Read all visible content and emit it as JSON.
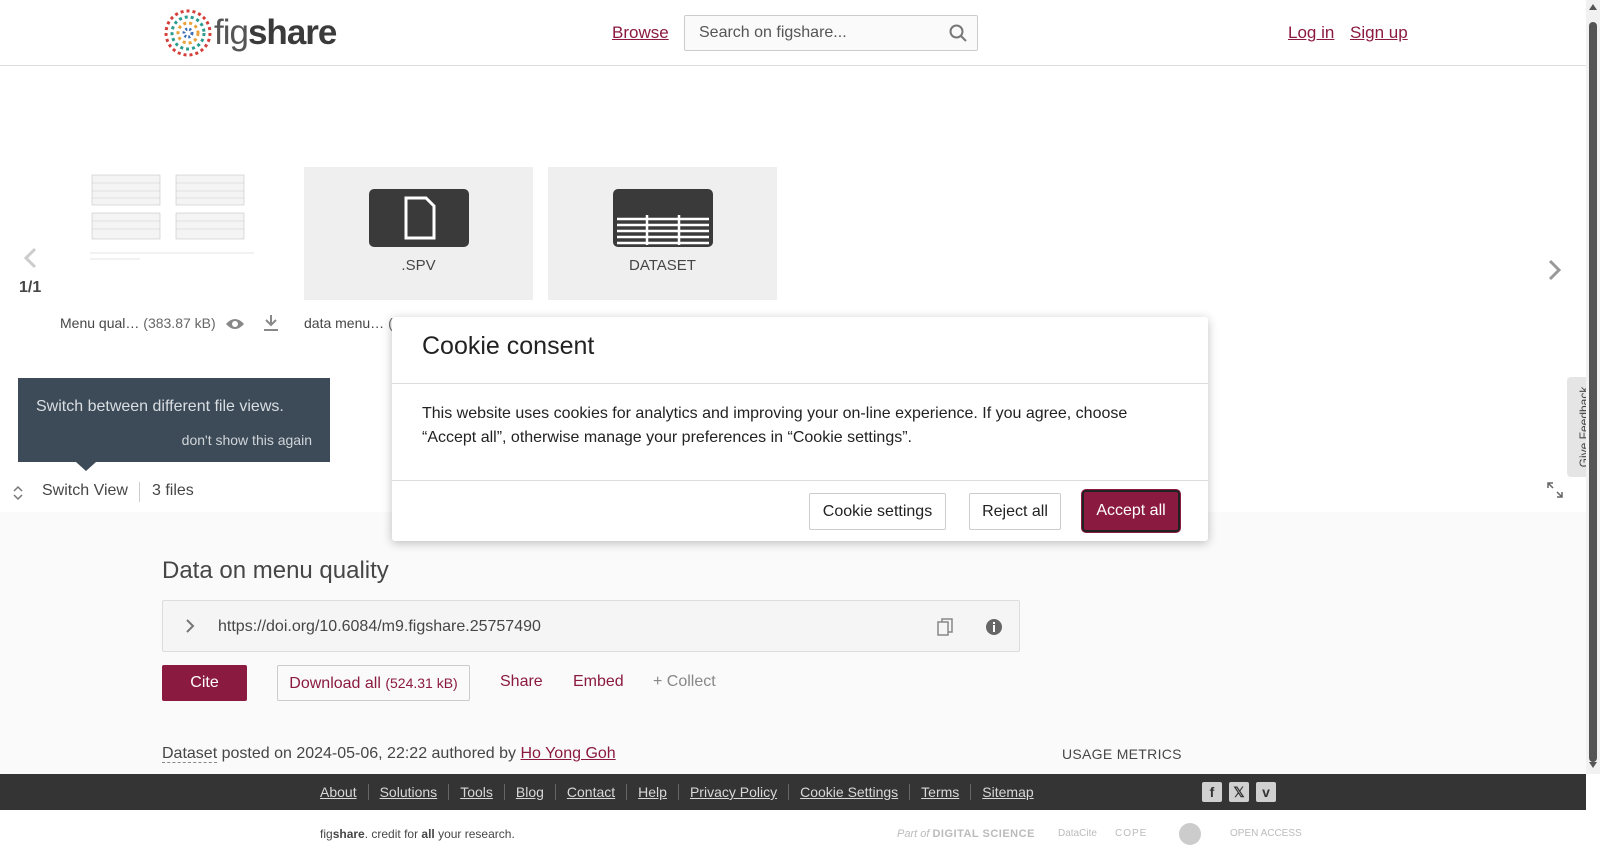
{
  "header": {
    "logo_prefix": "fig",
    "logo_suffix": "share",
    "browse_label": "Browse",
    "search_placeholder": "Search on figshare...",
    "login_label": "Log in",
    "signup_label": "Sign up"
  },
  "viewer": {
    "page_count": "1/1",
    "files": [
      {
        "name": "Menu qual…",
        "size": "(383.87 kB)",
        "thumb_label": ""
      },
      {
        "name": "data menu…",
        "size": "(",
        "thumb_label": ".SPV"
      },
      {
        "name": "",
        "size": "",
        "thumb_label": "DATASET"
      }
    ],
    "tooltip_text": "Switch between different file views.",
    "tooltip_dismiss": "don't show this again",
    "switch_view_label": "Switch View",
    "files_count": "3 files",
    "feedback_label": "Give Feedback"
  },
  "item": {
    "title": "Data on menu quality",
    "doi": "https://doi.org/10.6084/m9.figshare.25757490",
    "cite_label": "Cite",
    "download_label": "Download all",
    "download_size": "(524.31 kB)",
    "share_label": "Share",
    "embed_label": "Embed",
    "collect_label": "+ Collect",
    "posted_type": "Dataset",
    "posted_text": " posted on 2024-05-06, 22:22 authored by ",
    "author": "Ho Yong Goh",
    "usage_metrics": "USAGE METRICS"
  },
  "footer": {
    "links": [
      "About",
      "Solutions",
      "Tools",
      "Blog",
      "Contact",
      "Help",
      "Privacy Policy",
      "Cookie Settings",
      "Terms",
      "Sitemap"
    ],
    "credit_prefix": "fig",
    "credit_brand": "share",
    "credit_mid": ". credit for ",
    "credit_all": "all",
    "credit_end": " your research.",
    "partner_part_of": "Part of",
    "partner_ds": "DIGITAL SCIENCE",
    "partner_datacite": "DataCite",
    "partner_cope": "COPE",
    "partner_oa": "OPEN ACCESS"
  },
  "modal": {
    "title": "Cookie consent",
    "body": "This website uses cookies for analytics and improving your on-line experience. If you agree, choose “Accept all”, otherwise manage your preferences in “Cookie settings”.",
    "settings_label": "Cookie settings",
    "reject_label": "Reject all",
    "accept_label": "Accept all"
  },
  "colors": {
    "brand": "#8b1a40",
    "dark_footer": "#343434",
    "tooltip_bg": "#3d4a57"
  }
}
